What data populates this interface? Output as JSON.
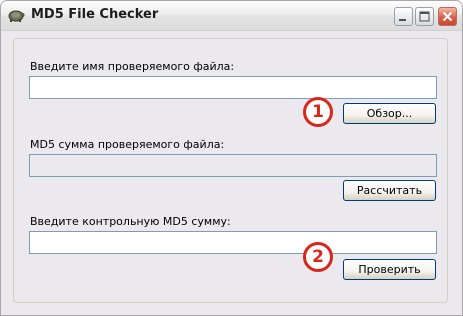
{
  "window": {
    "title": "MD5 File Checker",
    "app_icon": "tortoise-icon",
    "controls": [
      "minimize-icon",
      "maximize-icon",
      "close-icon"
    ]
  },
  "form": {
    "file_label": "Введите имя проверяемого файла:",
    "file_value": "",
    "browse_label": "Обзор...",
    "md5_label": "MD5 сумма проверяемого файла:",
    "md5_value": "",
    "calculate_label": "Рассчитать",
    "control_label": "Введите контрольную MD5 сумму:",
    "control_value": "",
    "verify_label": "Проверить"
  },
  "markers": [
    "1",
    "2"
  ],
  "colors": {
    "window_bg": "#ebe9ed",
    "input_border": "#7f9db9",
    "button_border": "#003c74",
    "marker_red": "#d8261b",
    "close_button": "#d9604a"
  }
}
